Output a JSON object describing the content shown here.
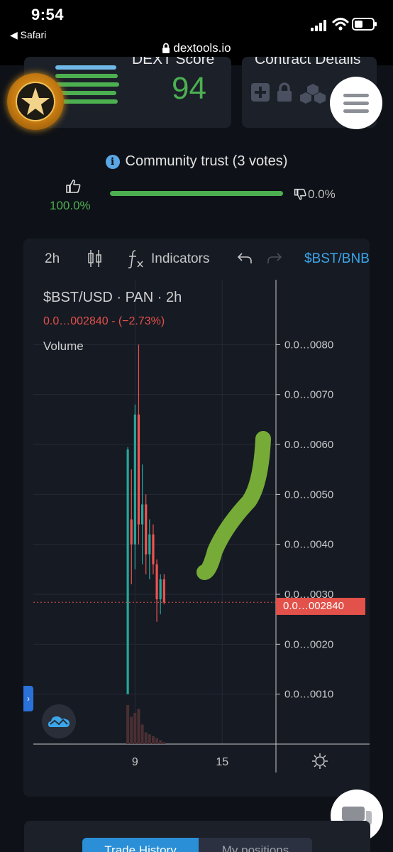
{
  "status_bar": {
    "time": "9:54",
    "back_app": "◀ Safari",
    "url": "dextools.io"
  },
  "dext_card": {
    "title": "DEXT Score",
    "score": "94"
  },
  "contract_card": {
    "title": "Contract Details"
  },
  "community": {
    "label": "Community trust (3 votes)",
    "upvote_pct": "100.0%",
    "downvote_pct": "0.0%"
  },
  "chart_toolbar": {
    "interval": "2h",
    "indicators": "Indicators",
    "symbol": "$BST/BNB"
  },
  "chart_legend": {
    "symbol_line": "$BST/USD · PAN · 2h",
    "price_line": "0.0…002840 - (−2.73%)",
    "volume_label": "Volume"
  },
  "last_price_label": "0.0…002840",
  "expand_glyph": "›",
  "tabs": {
    "trade_history": "Trade History",
    "my_positions": "My positions"
  },
  "chart_data": {
    "type": "candlestick",
    "title": "$BST/USD · PAN · 2h",
    "y_tick_labels": [
      "0.0…0080",
      "0.0…0070",
      "0.0…0060",
      "0.0…0050",
      "0.0…0040",
      "0.0…0030",
      "0.0…0020",
      "0.0…0010"
    ],
    "y_ticks": [
      8,
      7,
      6,
      5,
      4,
      3,
      2,
      1
    ],
    "x_tick_labels": [
      "9",
      "15"
    ],
    "x_ticks": [
      9,
      15
    ],
    "ylim": [
      0,
      9.3
    ],
    "xlim": [
      2,
      18.7
    ],
    "last_price": 2.84,
    "price_scale_note": "prices in units of 0.0…0001",
    "candles": [
      {
        "x": 8.5,
        "o": 1.0,
        "h": 5.95,
        "l": 1.0,
        "c": 5.9
      },
      {
        "x": 8.75,
        "o": 4.5,
        "h": 5.5,
        "l": 3.2,
        "c": 4.0
      },
      {
        "x": 9.0,
        "o": 4.0,
        "h": 6.8,
        "l": 3.5,
        "c": 6.6
      },
      {
        "x": 9.25,
        "o": 6.6,
        "h": 8.0,
        "l": 4.0,
        "c": 4.4
      },
      {
        "x": 9.5,
        "o": 4.4,
        "h": 5.6,
        "l": 3.6,
        "c": 4.8
      },
      {
        "x": 9.75,
        "o": 4.8,
        "h": 5.0,
        "l": 3.4,
        "c": 3.8
      },
      {
        "x": 10.0,
        "o": 3.8,
        "h": 4.5,
        "l": 3.3,
        "c": 4.2
      },
      {
        "x": 10.25,
        "o": 4.2,
        "h": 4.4,
        "l": 3.4,
        "c": 3.6
      },
      {
        "x": 10.5,
        "o": 3.6,
        "h": 3.7,
        "l": 2.45,
        "c": 2.9
      },
      {
        "x": 10.75,
        "o": 2.9,
        "h": 3.4,
        "l": 2.6,
        "c": 3.3
      },
      {
        "x": 11.0,
        "o": 3.3,
        "h": 3.4,
        "l": 2.8,
        "c": 2.84
      }
    ],
    "volume": [
      1.0,
      0.7,
      0.8,
      0.9,
      0.5,
      0.3,
      0.25,
      0.2,
      0.15,
      0.1,
      0.05
    ]
  }
}
